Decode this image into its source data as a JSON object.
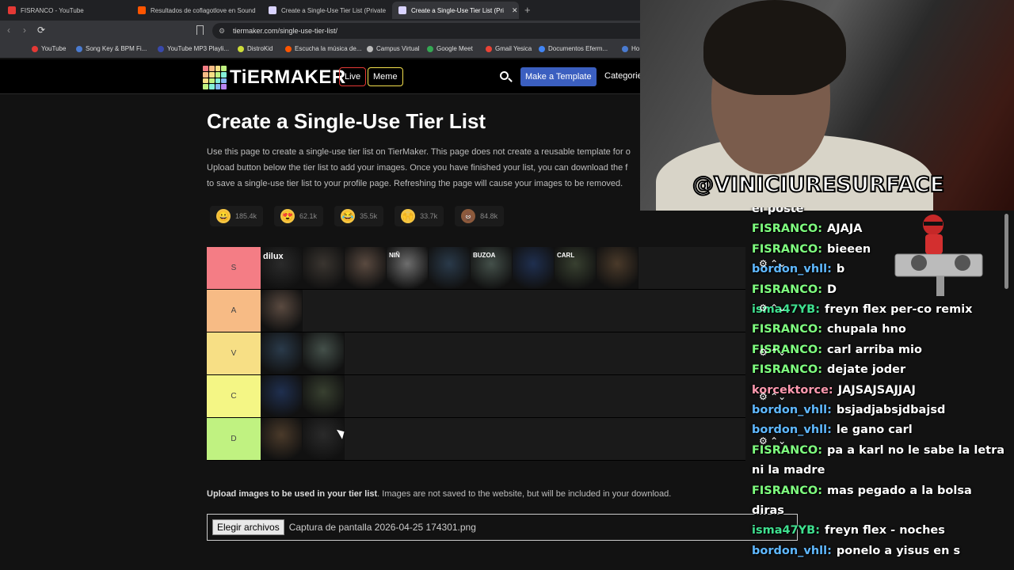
{
  "tabs": [
    {
      "title": "FISRANCO - YouTube",
      "color": "#e53935"
    },
    {
      "title": "Resultados de coflagotlove en Sound",
      "color": "#ff5500"
    },
    {
      "title": "Create a Single-Use Tier List (Private",
      "color": "#d9d3ff"
    },
    {
      "title": "Create a Single-Use Tier List (Pri",
      "color": "#d9d3ff",
      "active": true
    }
  ],
  "url": "tiermaker.com/single-use-tier-list/",
  "bookmarks": [
    {
      "label": "YouTube",
      "color": "#e53935"
    },
    {
      "label": "Song Key & BPM Fi...",
      "color": "#4a7bd0"
    },
    {
      "label": "YouTube MP3 Playli...",
      "color": "#3949ab"
    },
    {
      "label": "DistroKid",
      "color": "#cddc39"
    },
    {
      "label": "Escucha la música de...",
      "color": "#ff5500"
    },
    {
      "label": "Campus Virtual",
      "color": "#bbb"
    },
    {
      "label": "Google Meet",
      "color": "#34a853"
    },
    {
      "label": "Gmail Yesica",
      "color": "#ea4335"
    },
    {
      "label": "Documentos Eferm...",
      "color": "#4285f4"
    },
    {
      "label": "Ho",
      "color": "#4a7bd0"
    }
  ],
  "header": {
    "logo": "TiERMAKER",
    "live": "Live",
    "meme": "Meme",
    "make_template": "Make a Template",
    "categories": "Categorie"
  },
  "page": {
    "title": "Create a Single-Use Tier List",
    "intro_lines": [
      "Use this page to create a single-use tier list on TierMaker. This page does not create a reusable template for o",
      "Upload button below the tier list to add your images. Once you have finished your list, you can download the f",
      "to save a single-use tier list to your profile page. Refreshing the page will cause your images to be removed."
    ],
    "reactions": [
      {
        "emoji": "😀",
        "count": "185.4k"
      },
      {
        "emoji": "😍",
        "count": "62.1k"
      },
      {
        "emoji": "😂",
        "count": "35.5k"
      },
      {
        "emoji": "🙌",
        "count": "33.7k"
      },
      {
        "emoji": "💩",
        "count": "84.8k"
      }
    ],
    "tiers": [
      {
        "label": "S",
        "color": "#f47d85",
        "count": 9
      },
      {
        "label": "A",
        "color": "#f7bb85",
        "count": 1
      },
      {
        "label": "V",
        "color": "#f7df85",
        "count": 2
      },
      {
        "label": "C",
        "color": "#f4f685",
        "count": 2
      },
      {
        "label": "D",
        "color": "#c0f281",
        "count": 2
      }
    ],
    "tier_image_captions": [
      "dilux",
      "NIÑ",
      "BUZOA",
      "CARL"
    ],
    "upload_bold": "Upload images to be used in your tier list",
    "upload_rest": ". Images are not saved to the website, but will be included in your download.",
    "file_button": "Elegir archivos",
    "file_name": "Captura de pantalla 2026-04-25 174301.png"
  },
  "cam": {
    "name": "@VINICIURESURFACE"
  },
  "chat": [
    {
      "user": "",
      "text": "el poste",
      "color": "#ffffff"
    },
    {
      "user": "FISRANCO:",
      "text": "AJAJA",
      "color": "#7fff7f"
    },
    {
      "user": "FISRANCO:",
      "text": "bieeen",
      "color": "#7fff7f"
    },
    {
      "user": "bordon_vhll:",
      "text": "b",
      "color": "#5fb8ff"
    },
    {
      "user": "FISRANCO:",
      "text": "D",
      "color": "#7fff7f"
    },
    {
      "user": "isma47YB:",
      "text": "freyn flex per-co remix",
      "color": "#3fe08f"
    },
    {
      "user": "FISRANCO:",
      "text": "chupala hno",
      "color": "#7fff7f"
    },
    {
      "user": "FISRANCO:",
      "text": "carl arriba mio",
      "color": "#7fff7f"
    },
    {
      "user": "FISRANCO:",
      "text": "dejate joder",
      "color": "#7fff7f"
    },
    {
      "user": "korcektorce:",
      "text": "JAJSAJSAJJAJ",
      "color": "#ff9ab0"
    },
    {
      "user": "bordon_vhll:",
      "text": "bsjadjabsjdbajsd",
      "color": "#5fb8ff"
    },
    {
      "user": "bordon_vhll:",
      "text": "le gano carl",
      "color": "#5fb8ff"
    },
    {
      "user": "FISRANCO:",
      "text": "pa a karl no le sabe la letra",
      "color": "#7fff7f"
    },
    {
      "user": "",
      "text": "ni la madre",
      "color": "#ffffff"
    },
    {
      "user": "FISRANCO:",
      "text": "mas pegado a la bolsa",
      "color": "#7fff7f"
    },
    {
      "user": "",
      "text": "diras",
      "color": "#ffffff"
    },
    {
      "user": "isma47YB:",
      "text": "freyn flex - noches",
      "color": "#3fe08f"
    },
    {
      "user": "bordon_vhll:",
      "text": "ponelo a yisus en s",
      "color": "#5fb8ff"
    }
  ]
}
